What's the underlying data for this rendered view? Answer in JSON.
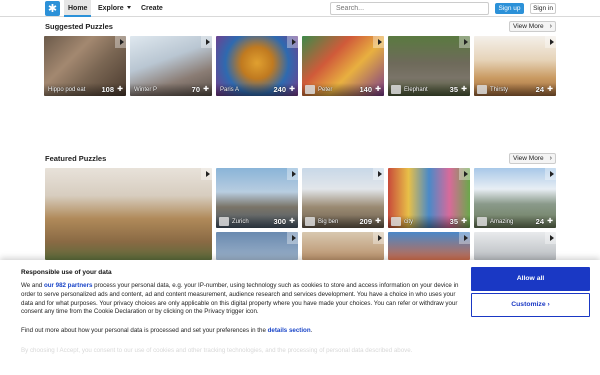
{
  "nav": {
    "home": "Home",
    "explore": "Explore",
    "create": "Create",
    "search_placeholder": "Search...",
    "signup": "Sign up",
    "signin": "Sign in"
  },
  "suggested": {
    "title": "Suggested Puzzles",
    "view_more": "View More",
    "items": [
      {
        "name": "Hippo pod eat",
        "count": "108"
      },
      {
        "name": "Winter P",
        "count": "70"
      },
      {
        "name": "Paris A",
        "count": "240"
      },
      {
        "name": "Peter",
        "count": "140"
      },
      {
        "name": "Elephant",
        "count": "35"
      },
      {
        "name": "Thirsty",
        "count": "24"
      }
    ]
  },
  "featured": {
    "title": "Featured Puzzles",
    "view_more": "View More",
    "items": [
      {
        "name": "Zurich",
        "count": "300"
      },
      {
        "name": "Big ben",
        "count": "209"
      },
      {
        "name": "city",
        "count": "35"
      },
      {
        "name": "Amazing",
        "count": "24"
      }
    ]
  },
  "cookie": {
    "title": "Responsible use of your data",
    "text_before": "We and ",
    "partners_link": "our 982 partners",
    "text_after": " process your personal data, e.g. your IP-number, using technology such as cookies to store and access information on your device in order to serve personalized ads and content, ad and content measurement, audience research and services development. You have a choice in who uses your data and for what purposes. Your privacy choices are only applicable on this digital property where you have made your choices. You can refer or withdraw your consent any time from the Cookie Declaration or by clicking on the Privacy trigger icon.",
    "more_before": "Find out more about how your personal data is processed and set your preferences in the ",
    "details_link": "details section",
    "more_after": ".",
    "faded": "By choosing I Accept, you consent to our use of cookies and other tracking technologies, and the processing of personal data described above.",
    "allow_all": "Allow all",
    "customize": "Customize"
  },
  "colors": {
    "brand": "#2c91d8",
    "consent_primary": "#1a38c4"
  }
}
